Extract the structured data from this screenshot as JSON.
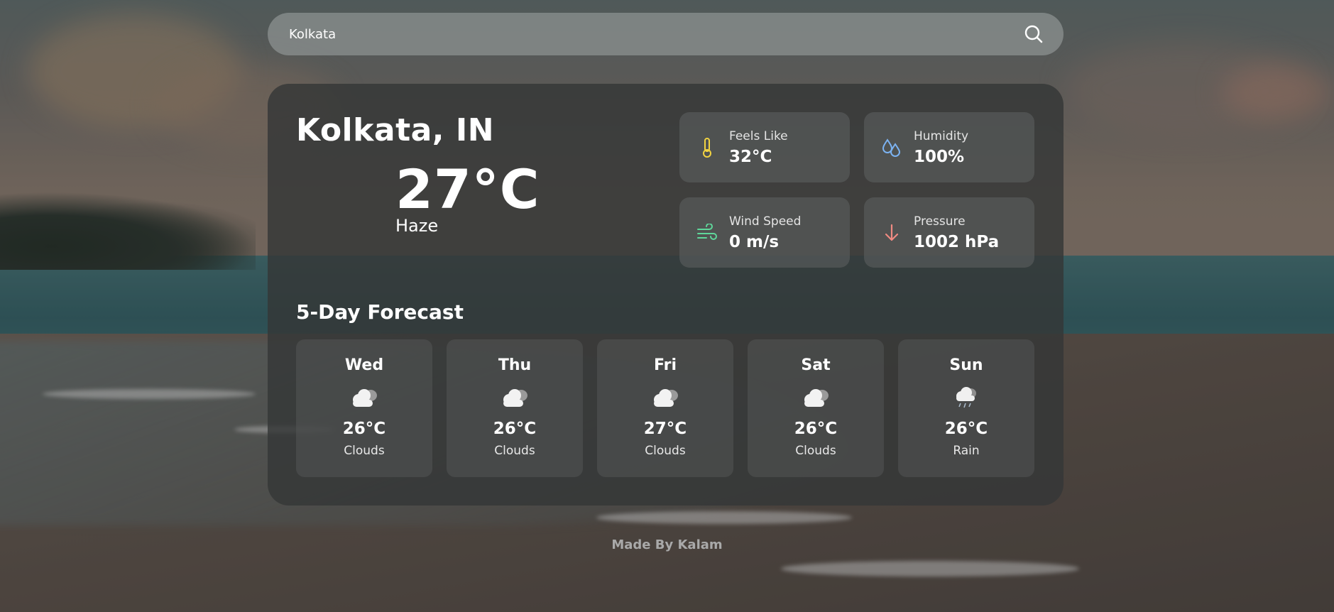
{
  "search": {
    "value": "Kolkata",
    "placeholder": ""
  },
  "current": {
    "location": "Kolkata, IN",
    "temperature": "27°C",
    "condition": "Haze"
  },
  "stats": [
    {
      "label": "Feels Like",
      "value": "32°C",
      "icon": "thermometer-icon",
      "color": "#f2d341"
    },
    {
      "label": "Humidity",
      "value": "100%",
      "icon": "water-drops-icon",
      "color": "#7cb3f2"
    },
    {
      "label": "Wind Speed",
      "value": "0 m/s",
      "icon": "wind-icon",
      "color": "#5fd69a"
    },
    {
      "label": "Pressure",
      "value": "1002 hPa",
      "icon": "arrow-down-icon",
      "color": "#f08a82"
    }
  ],
  "forecast": {
    "title": "5-Day Forecast",
    "days": [
      {
        "day": "Wed",
        "temp": "26°C",
        "desc": "Clouds",
        "icon": "cloud-icon"
      },
      {
        "day": "Thu",
        "temp": "26°C",
        "desc": "Clouds",
        "icon": "cloud-icon"
      },
      {
        "day": "Fri",
        "temp": "27°C",
        "desc": "Clouds",
        "icon": "cloud-icon"
      },
      {
        "day": "Sat",
        "temp": "26°C",
        "desc": "Clouds",
        "icon": "cloud-icon"
      },
      {
        "day": "Sun",
        "temp": "26°C",
        "desc": "Rain",
        "icon": "rain-cloud-icon"
      }
    ]
  },
  "footer": {
    "text": "Made By Kalam"
  }
}
